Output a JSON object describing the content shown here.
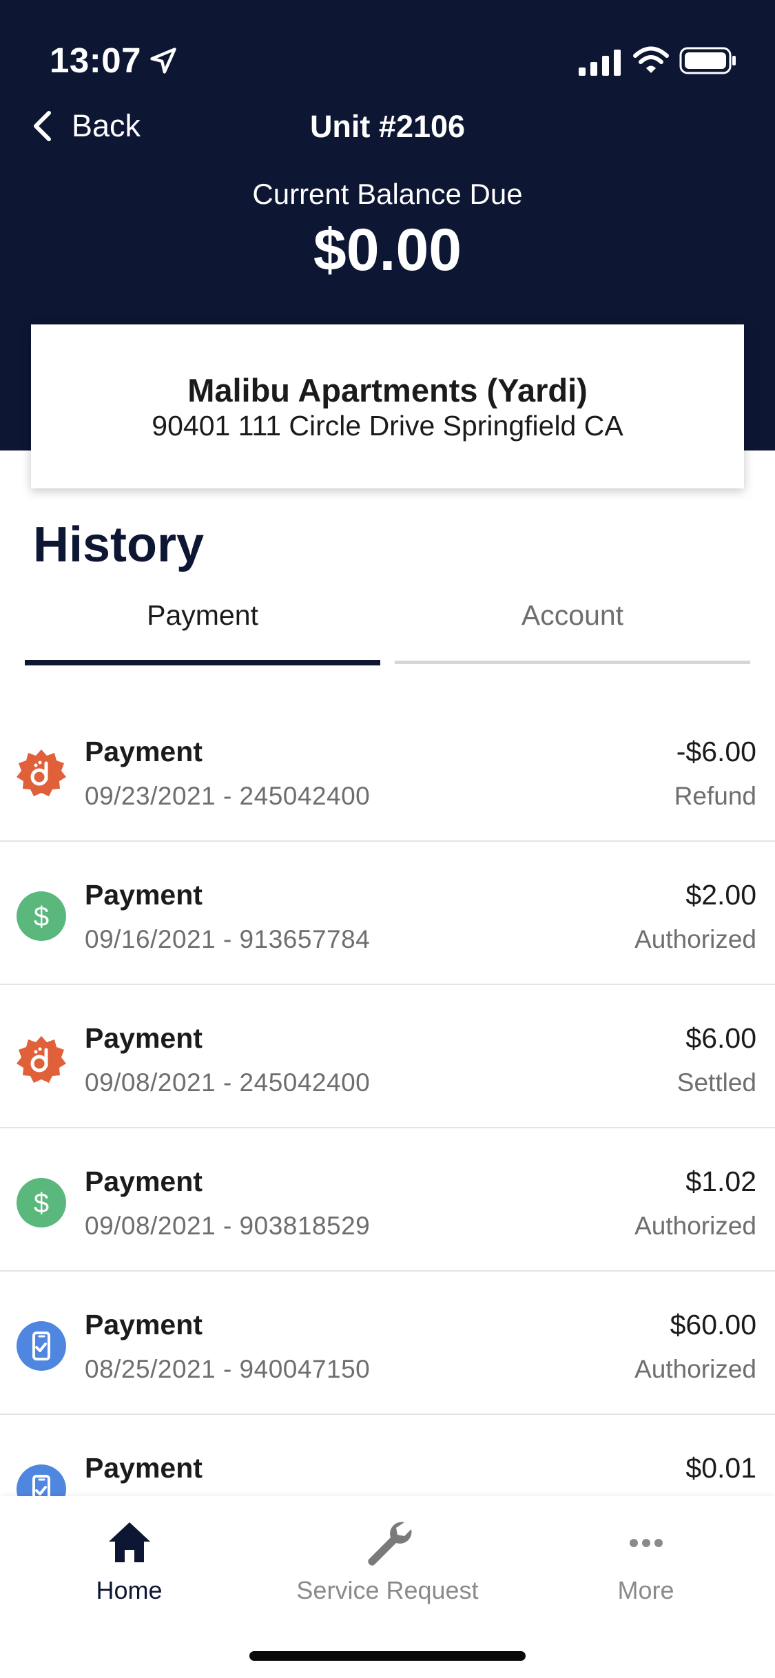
{
  "status_bar": {
    "time": "13:07",
    "icons": [
      "location-arrow-icon",
      "signal-bars-icon",
      "wifi-icon",
      "battery-icon"
    ]
  },
  "nav": {
    "back_label": "Back",
    "title": "Unit #2106"
  },
  "balance": {
    "label": "Current Balance Due",
    "amount": "$0.00"
  },
  "property": {
    "name": "Malibu Apartments (Yardi)",
    "address": "90401 111 Circle Drive Springfield CA"
  },
  "history": {
    "title": "History",
    "tabs": [
      {
        "label": "Payment",
        "active": true
      },
      {
        "label": "Account",
        "active": false
      }
    ],
    "transactions": [
      {
        "title": "Payment",
        "subtitle": "09/23/2021 - 245042400",
        "amount": "-$6.00",
        "status": "Refund",
        "icon": "badge-d-icon",
        "icon_color": "#e0603a"
      },
      {
        "title": "Payment",
        "subtitle": "09/16/2021 - 913657784",
        "amount": "$2.00",
        "status": "Authorized",
        "icon": "dollar-icon",
        "icon_color": "#5bb87c"
      },
      {
        "title": "Payment",
        "subtitle": "09/08/2021 - 245042400",
        "amount": "$6.00",
        "status": "Settled",
        "icon": "badge-d-icon",
        "icon_color": "#e0603a"
      },
      {
        "title": "Payment",
        "subtitle": "09/08/2021 - 903818529",
        "amount": "$1.02",
        "status": "Authorized",
        "icon": "dollar-icon",
        "icon_color": "#5bb87c"
      },
      {
        "title": "Payment",
        "subtitle": "08/25/2021 - 940047150",
        "amount": "$60.00",
        "status": "Authorized",
        "icon": "phone-check-icon",
        "icon_color": "#4f86e0"
      },
      {
        "title": "Payment",
        "subtitle": "",
        "amount": "$0.01",
        "status": "",
        "icon": "phone-check-icon",
        "icon_color": "#4f86e0"
      }
    ]
  },
  "tab_bar": {
    "items": [
      {
        "label": "Home",
        "icon": "home-icon",
        "active": true
      },
      {
        "label": "Service Request",
        "icon": "wrench-icon",
        "active": false
      },
      {
        "label": "More",
        "icon": "more-dots-icon",
        "active": false
      }
    ]
  },
  "colors": {
    "navy": "#0d1633",
    "refund_badge": "#e0603a",
    "dollar_green": "#5bb87c",
    "phone_blue": "#4f86e0"
  }
}
